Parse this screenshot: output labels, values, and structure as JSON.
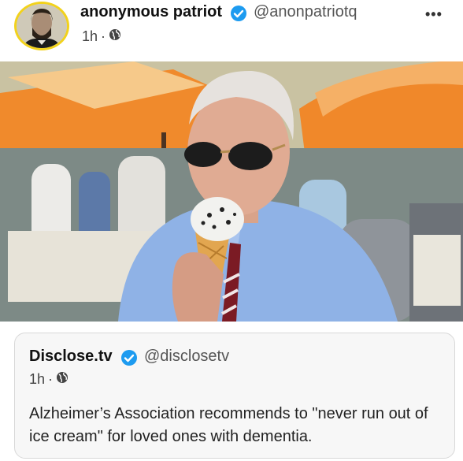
{
  "post": {
    "author_name": "anonymous patriot",
    "author_handle": "@anonpatriotq",
    "time": "1h",
    "separator": "·",
    "more_label": "•••"
  },
  "quoted_post": {
    "author_name": "Disclose.tv",
    "author_handle": "@disclosetv",
    "time": "1h",
    "separator": "·",
    "text": "Alzheimer’s Association recommends to \"never run out of ice cream\" for loved ones with dementia."
  },
  "colors": {
    "verified_blue": "#1d9bf0",
    "avatar_ring": "#f2d21c",
    "umbrella_orange": "#f08a2c",
    "shirt_blue": "#8fb2e6"
  },
  "icons": {
    "globe": "globe-icon",
    "verified": "verified-badge-icon",
    "more": "more-options-icon"
  }
}
